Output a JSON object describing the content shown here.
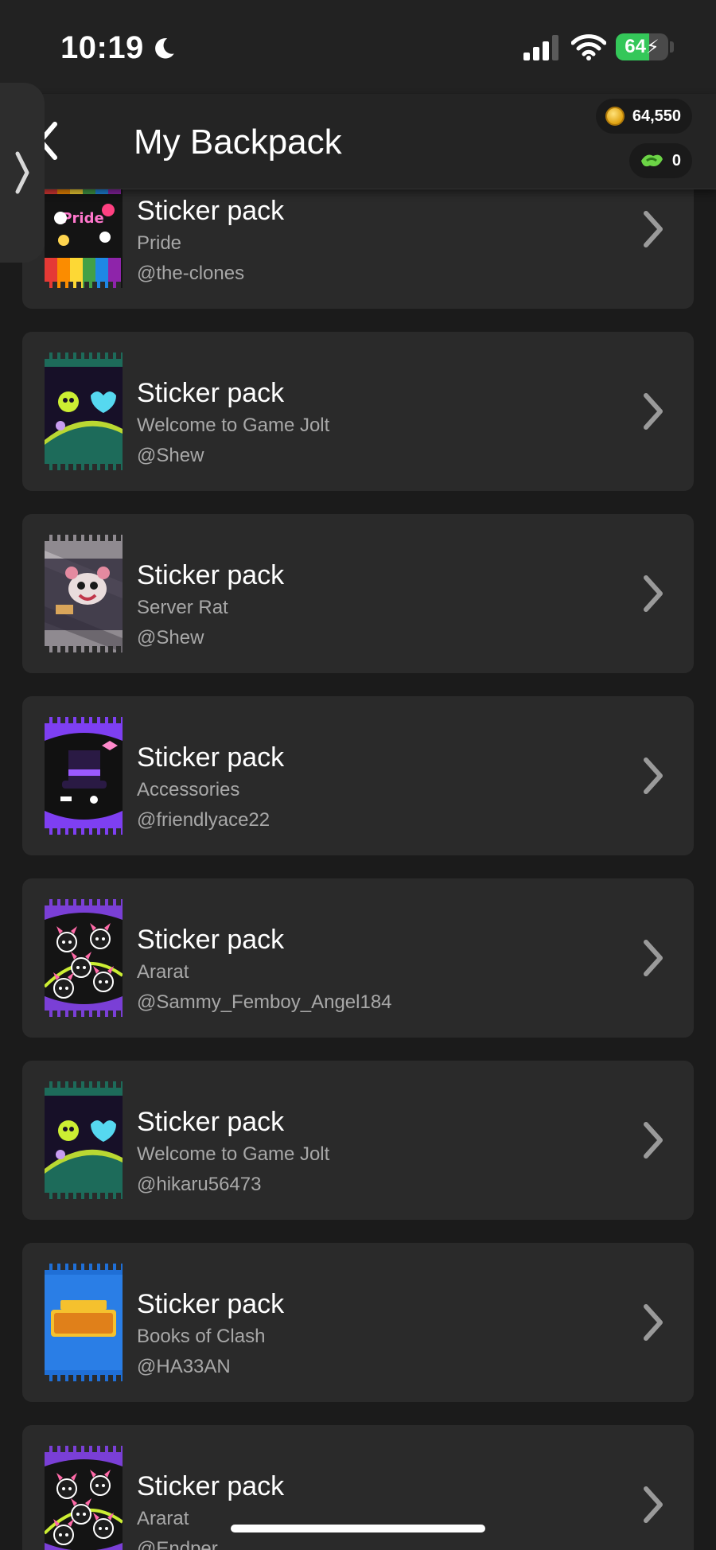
{
  "status_bar": {
    "time": "10:19",
    "battery": "64",
    "battery_level": 0.64
  },
  "header": {
    "title": "My Backpack",
    "coins": "64,550",
    "joltbux": "0"
  },
  "colors": {
    "background": "#1b1b1b",
    "card": "#2a2a2a",
    "battery_green": "#34c759",
    "coin_gold": "#e0a312",
    "joltbux_green": "#6cd446"
  },
  "items": [
    {
      "title": "Sticker pack",
      "name": "Pride",
      "owner": "@the-clones",
      "art": "pride"
    },
    {
      "title": "Sticker pack",
      "name": "Welcome to Game Jolt",
      "owner": "@Shew",
      "art": "welcome"
    },
    {
      "title": "Sticker pack",
      "name": "Server Rat",
      "owner": "@Shew",
      "art": "rat"
    },
    {
      "title": "Sticker pack",
      "name": "Accessories",
      "owner": "@friendlyace22",
      "art": "accessories"
    },
    {
      "title": "Sticker pack",
      "name": "Ararat",
      "owner": "@Sammy_Femboy_Angel184",
      "art": "ararat"
    },
    {
      "title": "Sticker pack",
      "name": "Welcome to Game Jolt",
      "owner": "@hikaru56473",
      "art": "welcome"
    },
    {
      "title": "Sticker pack",
      "name": "Books of Clash",
      "owner": "@HA33AN",
      "art": "books"
    },
    {
      "title": "Sticker pack",
      "name": "Ararat",
      "owner": "@Endper",
      "art": "ararat"
    }
  ]
}
